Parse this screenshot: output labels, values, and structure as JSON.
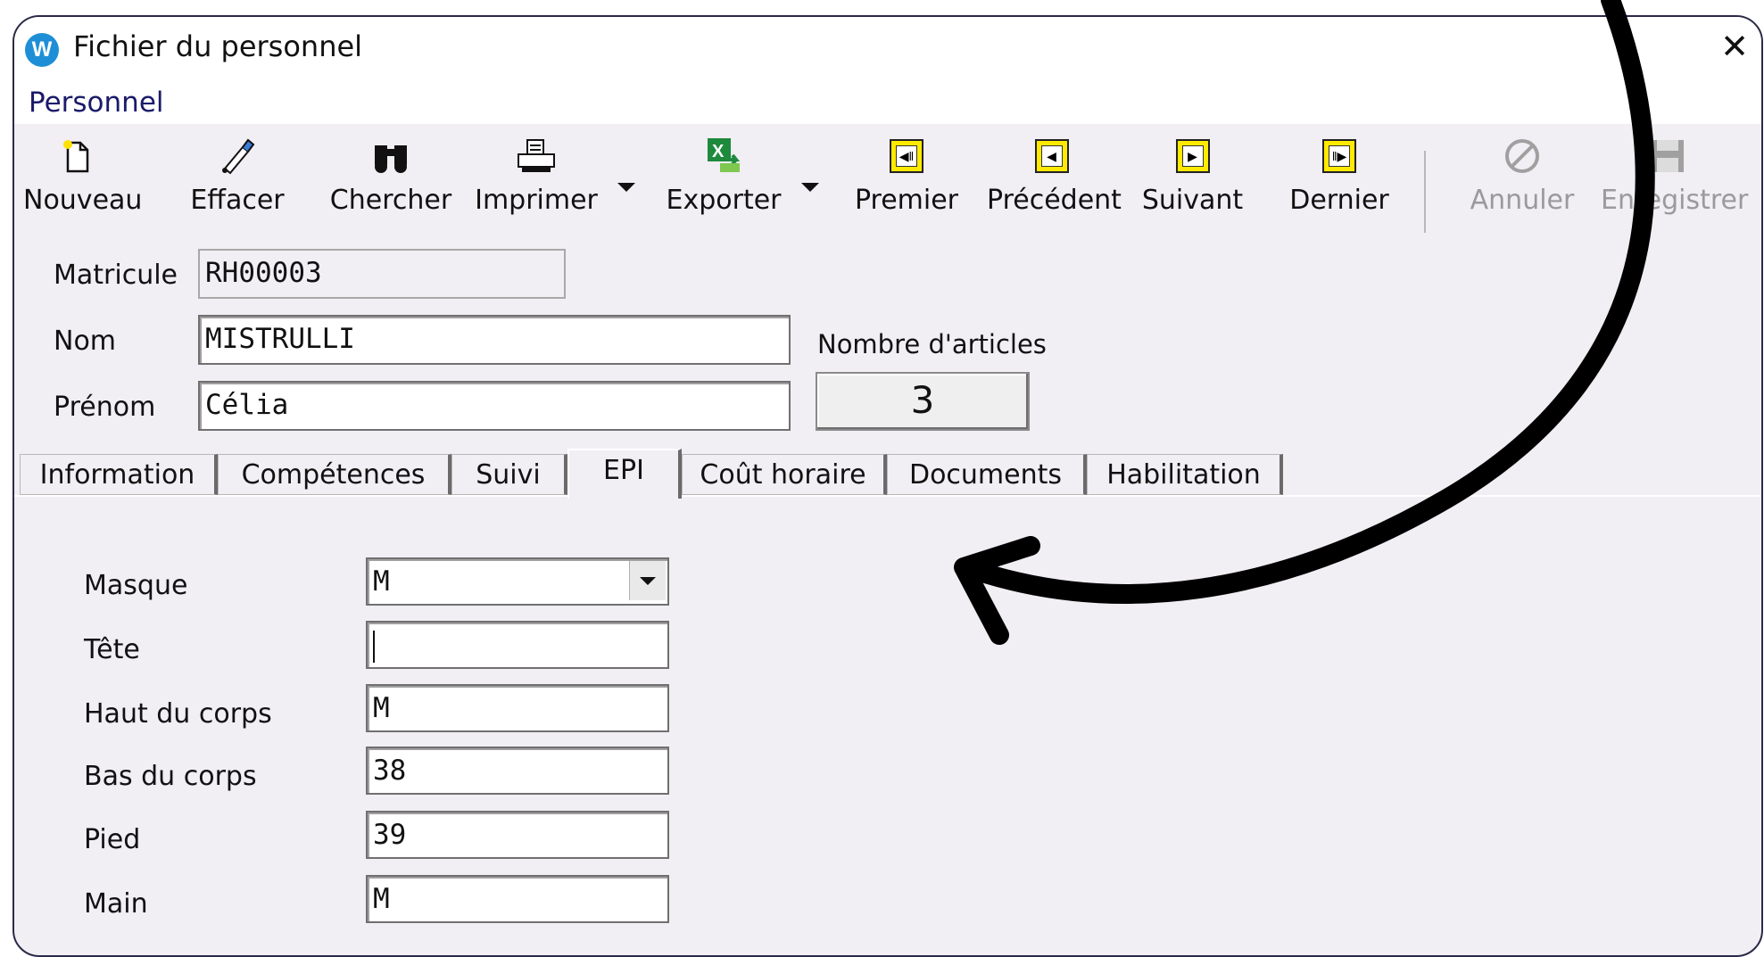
{
  "window": {
    "title": "Fichier du personnel",
    "app_icon_letter": "W",
    "close_label": "✕"
  },
  "menu": {
    "items": [
      "Personnel"
    ]
  },
  "toolbar": {
    "nouveau": "Nouveau",
    "effacer": "Effacer",
    "chercher": "Chercher",
    "imprimer": "Imprimer",
    "exporter": "Exporter",
    "premier": "Premier",
    "precedent": "Précédent",
    "suivant": "Suivant",
    "dernier": "Dernier",
    "annuler": "Annuler",
    "enregistrer": "Enregistrer"
  },
  "record": {
    "matricule_label": "Matricule",
    "matricule_value": "RH00003",
    "nom_label": "Nom",
    "nom_value": "MISTRULLI",
    "prenom_label": "Prénom",
    "prenom_value": "Célia",
    "articles_label": "Nombre d'articles",
    "articles_value": "3"
  },
  "tabs": [
    {
      "label": "Information"
    },
    {
      "label": "Compétences"
    },
    {
      "label": "Suivi"
    },
    {
      "label": "EPI",
      "active": true
    },
    {
      "label": "Coût horaire"
    },
    {
      "label": "Documents"
    },
    {
      "label": "Habilitation"
    }
  ],
  "epi": {
    "masque_label": "Masque",
    "masque_value": "M",
    "tete_label": "Tête",
    "tete_value": "",
    "haut_label": "Haut du corps",
    "haut_value": "M",
    "bas_label": "Bas du corps",
    "bas_value": "38",
    "pied_label": "Pied",
    "pied_value": "39",
    "main_label": "Main",
    "main_value": "M"
  },
  "colors": {
    "window_bg": "#f1eef4",
    "nav_icon": "#ffea00",
    "annotation_arrow": "#000000"
  },
  "icons": [
    "new-document-icon",
    "eraser-icon",
    "binoculars-icon",
    "printer-icon",
    "excel-export-icon",
    "first-record-icon",
    "previous-record-icon",
    "next-record-icon",
    "last-record-icon",
    "cancel-icon",
    "save-icon"
  ]
}
